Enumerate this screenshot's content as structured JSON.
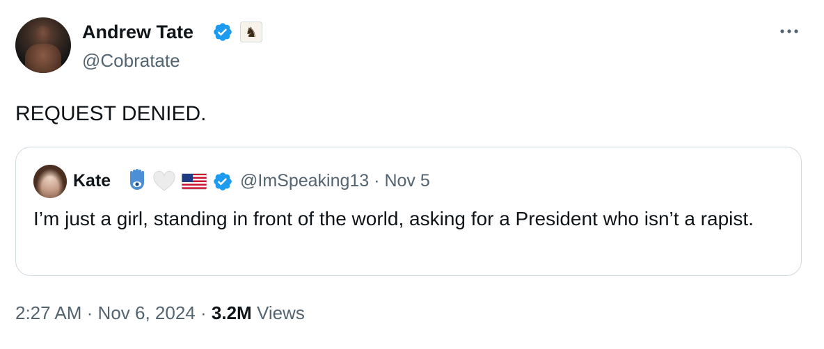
{
  "author": {
    "name": "Andrew Tate",
    "handle": "@Cobratate",
    "affiliate_badge_icon": "chess-knight-icon",
    "verified_color": "#1d9bf0"
  },
  "tweet": {
    "text": "REQUEST DENIED."
  },
  "quoted": {
    "name": "Kate",
    "emoji_icons": [
      "hamsa-icon",
      "white-heart-icon",
      "us-flag-icon"
    ],
    "handle": "@ImSpeaking13",
    "separator": "·",
    "date": "Nov 5",
    "text": "I’m just a girl, standing in front of the world, asking for a President who isn’t a rapist."
  },
  "footer": {
    "time": "2:27 AM",
    "date": "Nov 6, 2024",
    "sep1": "·",
    "sep2": "·",
    "views_count": "3.2M",
    "views_label": "Views"
  }
}
